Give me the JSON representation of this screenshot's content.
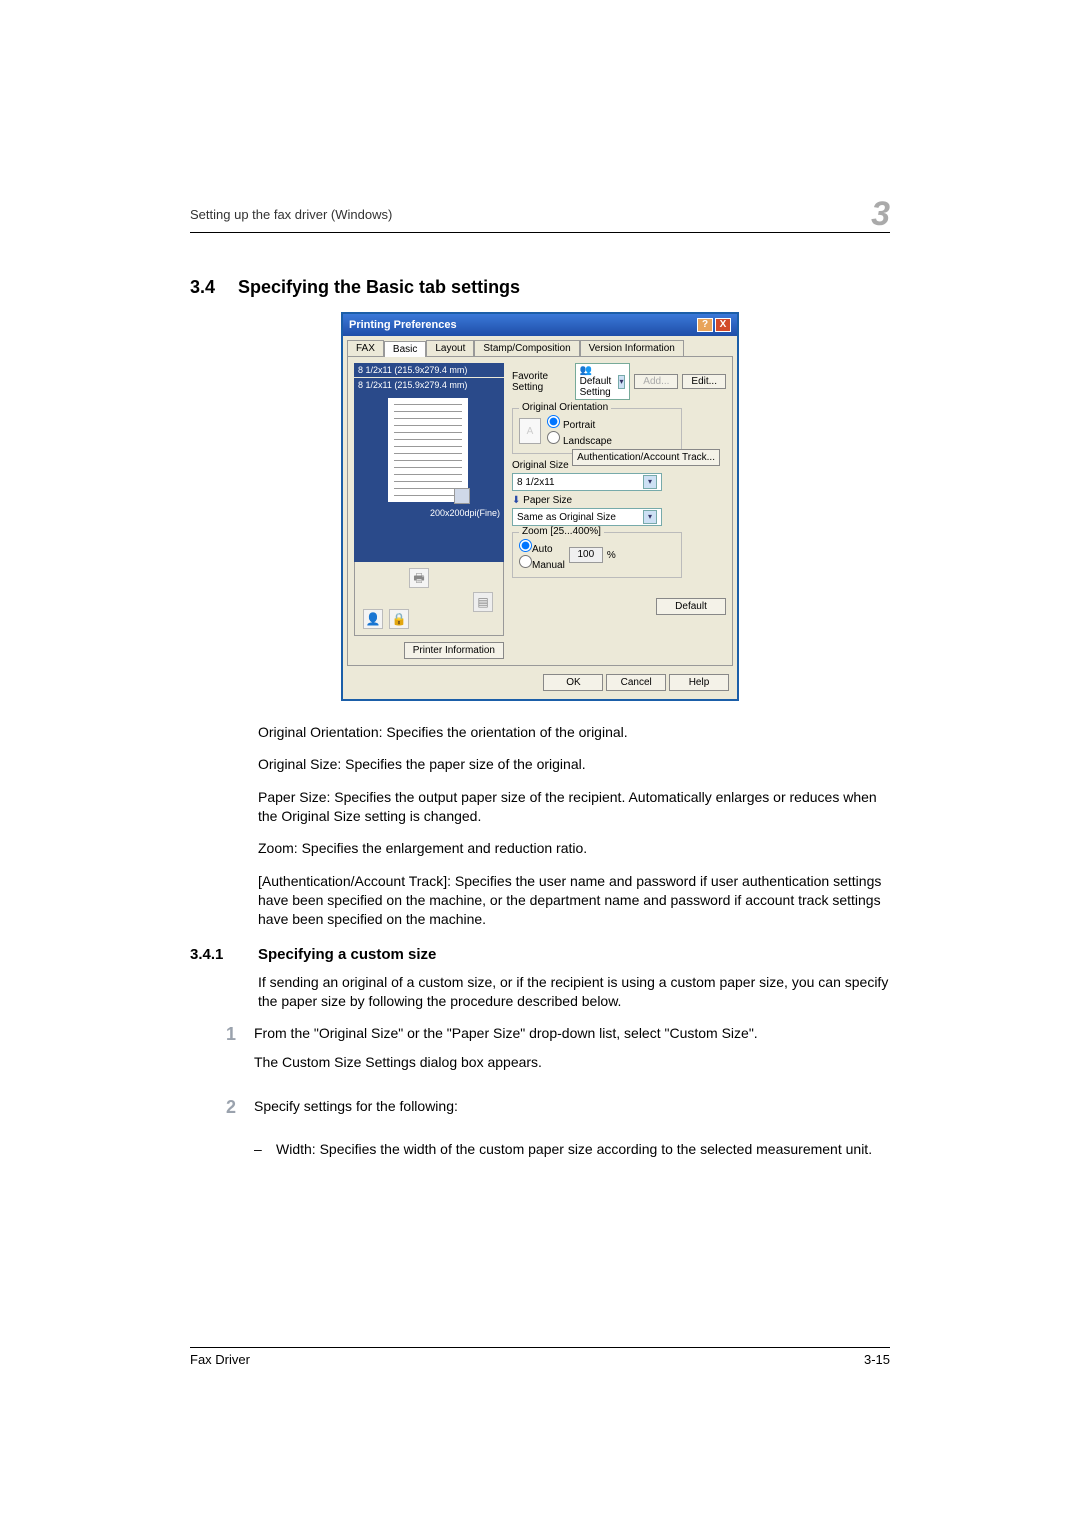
{
  "header": {
    "text": "Setting up the fax driver (Windows)",
    "chapter_mark": "3"
  },
  "section": {
    "number": "3.4",
    "title": "Specifying the Basic tab settings"
  },
  "dialog": {
    "title": "Printing Preferences",
    "titlebar_buttons": {
      "help": "?",
      "close": "X"
    },
    "tabs": [
      "FAX",
      "Basic",
      "Layout",
      "Stamp/Composition",
      "Version Information"
    ],
    "selected_tab_index": 1,
    "preview": {
      "line1": "8 1/2x11 (215.9x279.4 mm)",
      "line2": "8 1/2x11 (215.9x279.4 mm)",
      "dpi": "200x200dpi(Fine)"
    },
    "printer_info_btn": "Printer Information",
    "favorite": {
      "label": "Favorite Setting",
      "value": "Default Setting",
      "add_btn": "Add...",
      "edit_btn": "Edit..."
    },
    "orientation": {
      "legend": "Original Orientation",
      "portrait": "Portrait",
      "landscape": "Landscape",
      "selected": "portrait"
    },
    "original_size": {
      "label": "Original Size",
      "value": "8 1/2x11"
    },
    "paper_size": {
      "label": "Paper Size",
      "value": "Same as Original Size"
    },
    "zoom": {
      "legend": "Zoom [25...400%]",
      "auto": "Auto",
      "manual": "Manual",
      "value": "100",
      "percent": "%",
      "selected": "auto"
    },
    "auth_btn": "Authentication/Account Track...",
    "default_btn": "Default",
    "footer": {
      "ok": "OK",
      "cancel": "Cancel",
      "help": "Help"
    }
  },
  "body": {
    "p1": "Original Orientation: Specifies the orientation of the original.",
    "p2": "Original Size: Specifies the paper size of the original.",
    "p3": "Paper Size: Specifies the output paper size of the recipient. Automatically enlarges or reduces when the Original Size setting is changed.",
    "p4": "Zoom: Specifies the enlargement and reduction ratio.",
    "p5": "[Authentication/Account Track]: Specifies the user name and password if user authentication settings have been specified on the machine, or the department name and password if account track settings have been specified on the machine."
  },
  "subsection": {
    "number": "3.4.1",
    "title": "Specifying a custom size",
    "intro": "If sending an original of a custom size, or if the recipient is using a custom paper size, you can specify the paper size by following the procedure described below.",
    "steps": [
      {
        "num": "1",
        "text1": "From the \"Original Size\" or the \"Paper Size\" drop-down list, select \"Custom Size\".",
        "text2": "The Custom Size Settings dialog box appears."
      },
      {
        "num": "2",
        "text1": "Specify settings for the following:"
      }
    ],
    "sublist": [
      "Width: Specifies the width of the custom paper size according to the selected measurement unit."
    ]
  },
  "footer": {
    "left": "Fax Driver",
    "right": "3-15"
  }
}
